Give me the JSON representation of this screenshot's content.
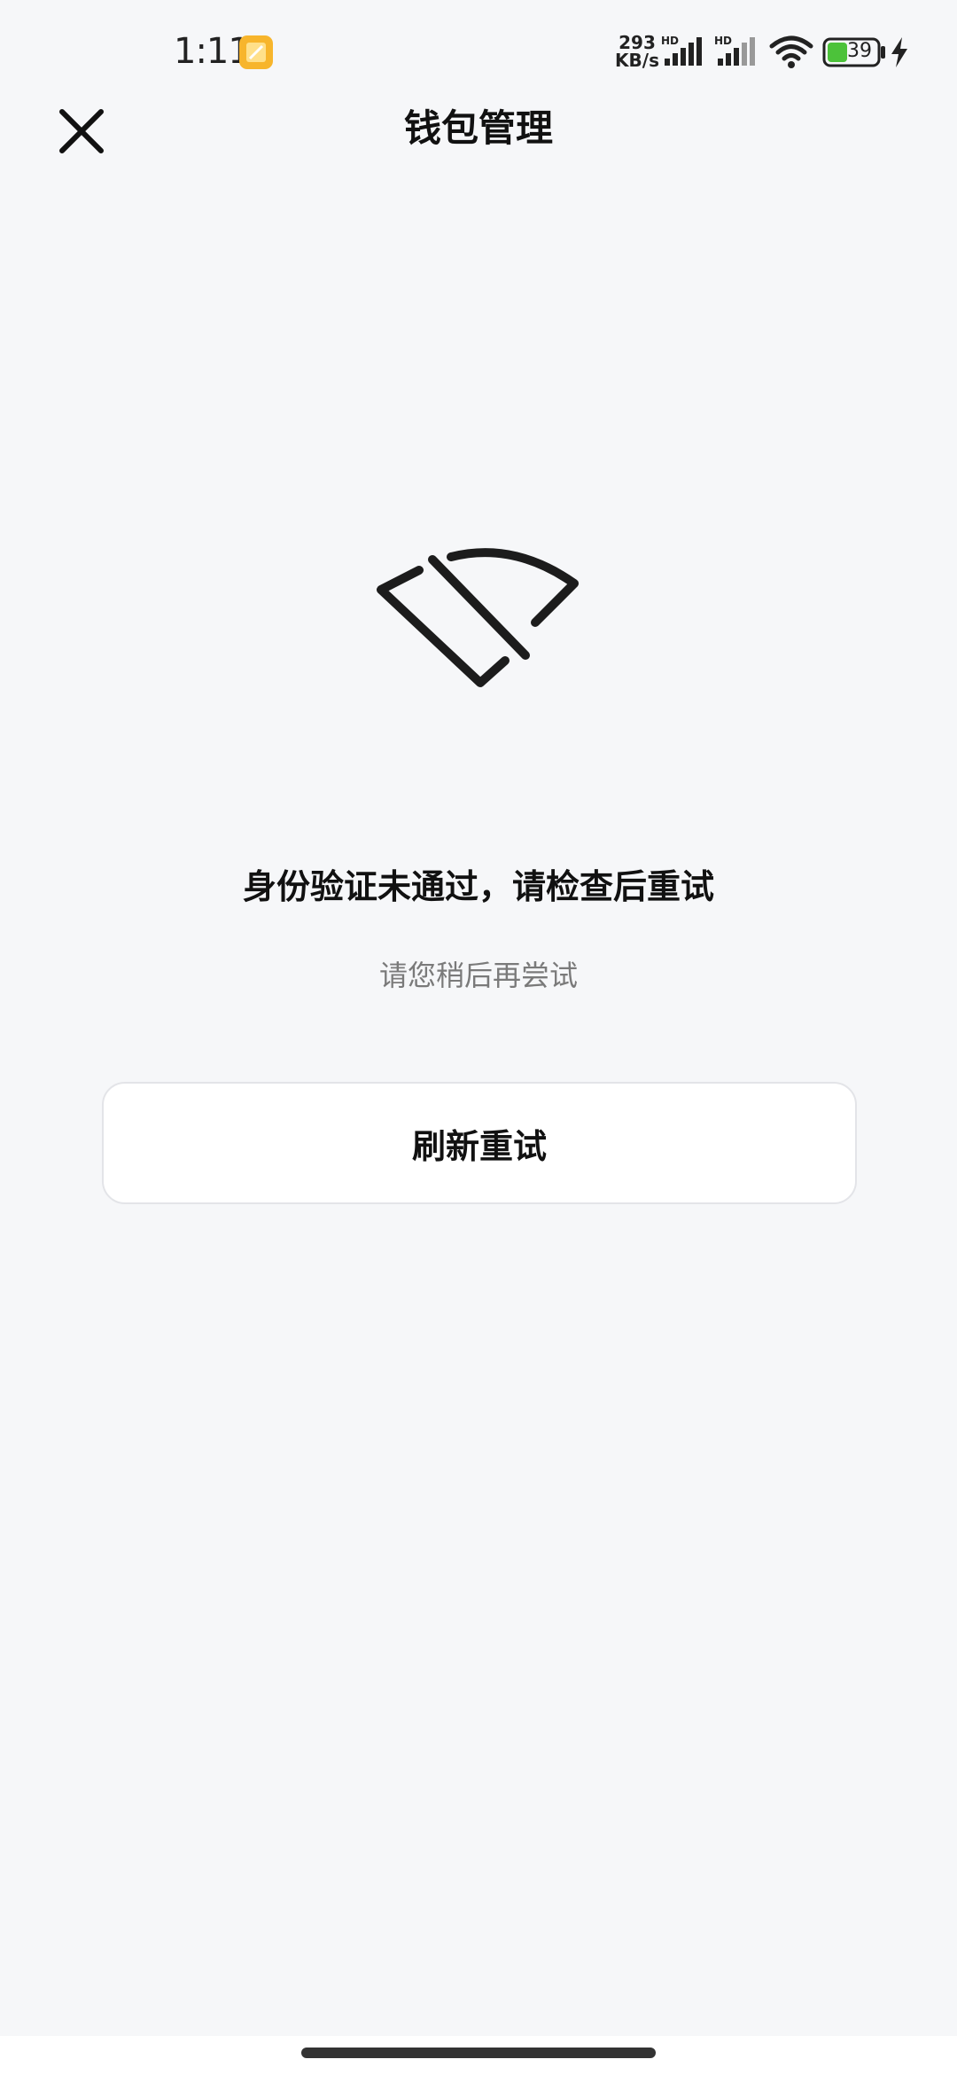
{
  "status_bar": {
    "time": "1:11",
    "net_speed_value": "293",
    "net_speed_unit": "KB/s",
    "signal_1_label": "HD",
    "signal_2_label": "HD",
    "battery_level": "39"
  },
  "header": {
    "title": "钱包管理",
    "close_icon": "close-icon"
  },
  "error": {
    "illustration_icon": "broken-signal-icon",
    "title": "身份验证未通过，请检查后重试",
    "subtitle": "请您稍后再尝试"
  },
  "actions": {
    "retry_label": "刷新重试"
  },
  "colors": {
    "background": "#f6f7f9",
    "text_primary": "#111111",
    "text_secondary": "#7a7a7a",
    "button_border": "#e3e4e8",
    "app_icon": "#f7b52c",
    "battery_fill": "#4cc23a"
  }
}
